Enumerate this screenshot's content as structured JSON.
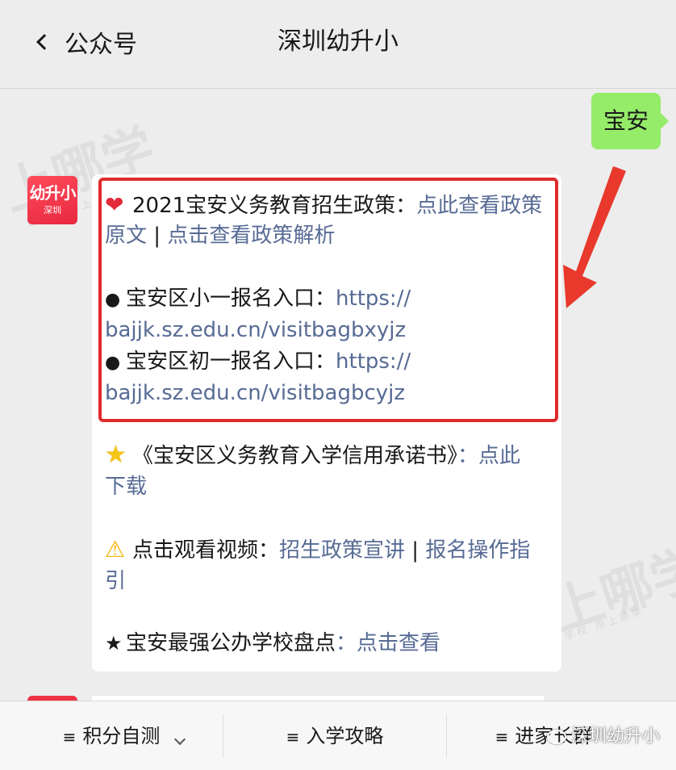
{
  "header": {
    "back_label": "公众号",
    "title": "深圳幼升小"
  },
  "user_message": "宝安",
  "avatar": {
    "line1": "幼升小",
    "line2": "深圳"
  },
  "message": {
    "policy_prefix": "2021宝安义务教育招生政策：",
    "policy_link1_a": "点此查看政策",
    "policy_link1_b": "原文",
    "separator": " | ",
    "policy_link2": "点击查看政策解析",
    "primary_label": "宝安区小一报名入口：",
    "primary_link_a": "https://",
    "primary_link_b": "bajjk.sz.edu.cn/visitbagbxyjz",
    "junior_label": "宝安区初一报名入口：",
    "junior_link_a": "https://",
    "junior_link_b": "bajjk.sz.edu.cn/visitbagbcyjz",
    "pledge_text": "《宝安区义务教育入学信用承诺书》",
    "pledge_colon": "：",
    "pledge_link_a": "点此",
    "pledge_link_b": "下载",
    "video_prefix": "点击观看视频：",
    "video_link1": "招生政策宣讲",
    "video_sep": " | ",
    "video_link2_a": "报名操作指",
    "video_link2_b": "引",
    "ranking_text": "宝安最强公办学校盘点",
    "ranking_colon": "：",
    "ranking_link": "点击查看"
  },
  "icons": {
    "heart": "heart-icon",
    "star": "star-icon",
    "warning": "warning-icon",
    "bullet": "bullet-icon",
    "black_star": "black-star-icon"
  },
  "watermark": {
    "text": "上哪学",
    "sub": "查学校 用上哪学"
  },
  "bottom_menu": {
    "item1": "积分自测",
    "item2": "入学攻略",
    "item3": "进家长群"
  },
  "footer_brand": "深圳幼升小",
  "colors": {
    "link": "#576b95",
    "user_bubble": "#95ec69",
    "highlight": "#e02b2b",
    "arrow": "#e8392c"
  }
}
